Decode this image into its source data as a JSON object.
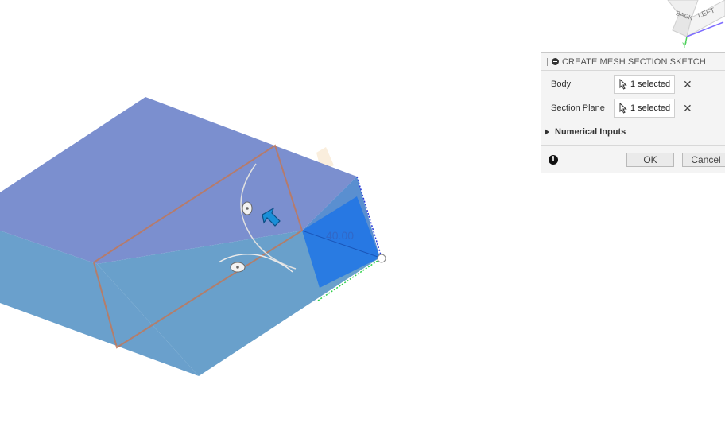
{
  "viewport": {
    "dimension_value": "40.00",
    "colors": {
      "body_top": "#7b8fcf",
      "body_side": "#6aa0cc",
      "section_plane": "#1f74e6",
      "sketch_outline": "#c0785a"
    }
  },
  "viewcube": {
    "face_back": "BACK",
    "face_left": "LEFT",
    "axis_y": "Y"
  },
  "panel": {
    "title": "CREATE MESH SECTION SKETCH",
    "body_label": "Body",
    "body_value": "1 selected",
    "plane_label": "Section Plane",
    "plane_value": "1 selected",
    "numerical_inputs_label": "Numerical Inputs",
    "ok_label": "OK",
    "cancel_label": "Cancel"
  }
}
